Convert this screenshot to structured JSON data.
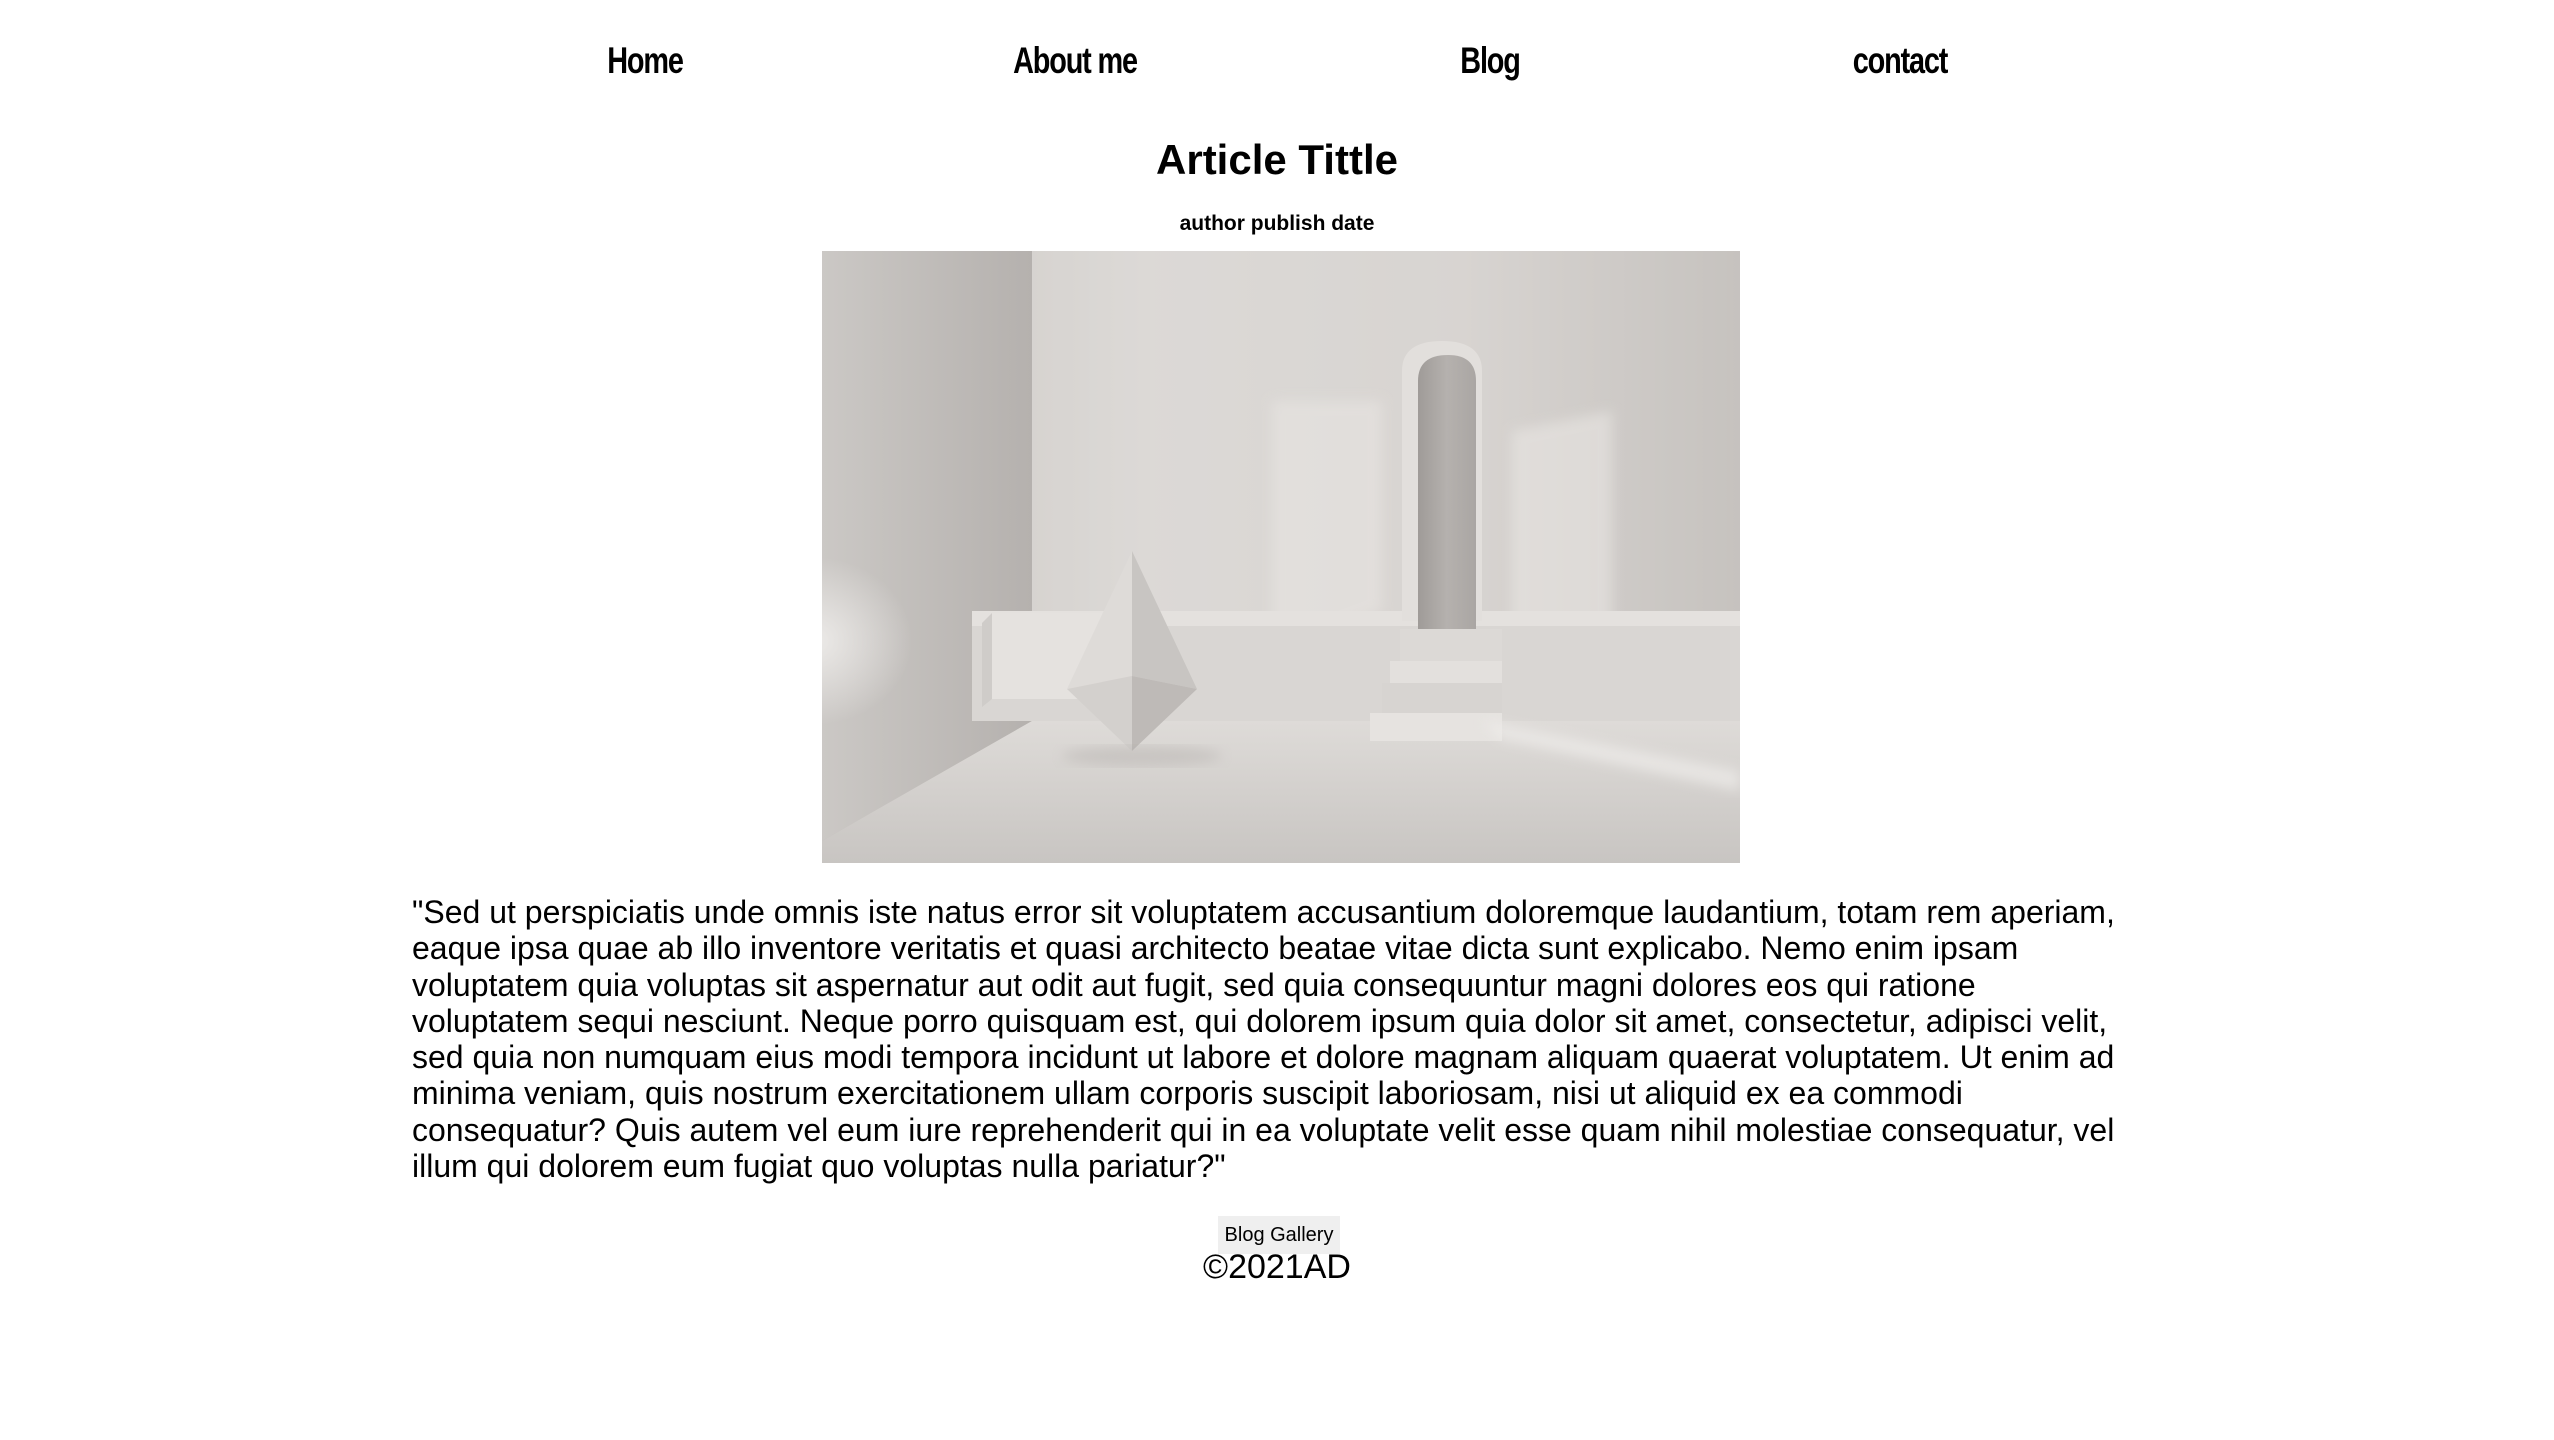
{
  "nav": {
    "items": [
      {
        "label": "Home"
      },
      {
        "label": "About me"
      },
      {
        "label": "Blog"
      },
      {
        "label": "contact"
      }
    ]
  },
  "article": {
    "title": "Article Tittle",
    "meta": "author publish date",
    "image_alt": "minimalist white room with pyramid crystal, steps and arched doorway",
    "body": "\"Sed ut perspiciatis unde omnis iste natus error sit voluptatem accusantium doloremque laudantium, totam rem aperiam, eaque ipsa quae ab illo inventore veritatis et quasi architecto beatae vitae dicta sunt explicabo. Nemo enim ipsam voluptatem quia voluptas sit aspernatur aut odit aut fugit, sed quia consequuntur magni dolores eos qui ratione voluptatem sequi nesciunt. Neque porro quisquam est, qui dolorem ipsum quia dolor sit amet, consectetur, adipisci velit, sed quia non numquam eius modi tempora incidunt ut labore et dolore magnam aliquam quaerat voluptatem. Ut enim ad minima veniam, quis nostrum exercitationem ullam corporis suscipit laboriosam, nisi ut aliquid ex ea commodi consequatur? Quis autem vel eum iure reprehenderit qui in ea voluptate velit esse quam nihil molestiae consequatur, vel illum qui dolorem eum fugiat quo voluptas nulla pariatur?\""
  },
  "actions": {
    "gallery_label": "Blog Gallery"
  },
  "footer": {
    "copyright": "©2021AD"
  }
}
